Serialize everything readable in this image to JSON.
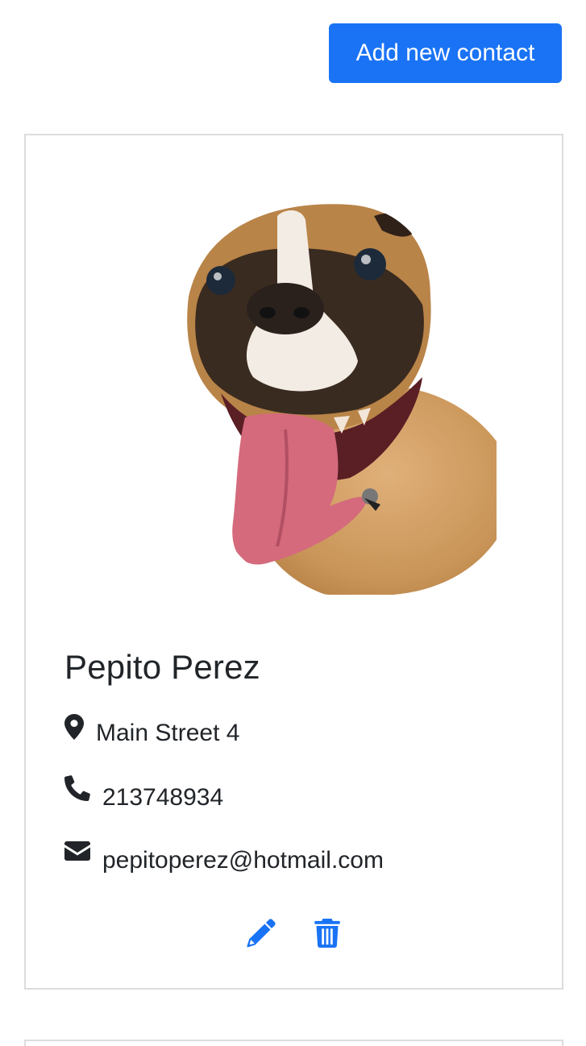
{
  "header": {
    "add_button_label": "Add new contact"
  },
  "contact": {
    "name": "Pepito Perez",
    "address": "Main Street 4",
    "phone": "213748934",
    "email": "pepitoperez@hotmail.com",
    "icons": {
      "address": "map-marker-icon",
      "phone": "phone-icon",
      "email": "envelope-icon",
      "edit": "pencil-icon",
      "delete": "trash-icon"
    }
  },
  "colors": {
    "primary": "#1a73f5",
    "text": "#212529",
    "border": "#dcdcdc"
  }
}
